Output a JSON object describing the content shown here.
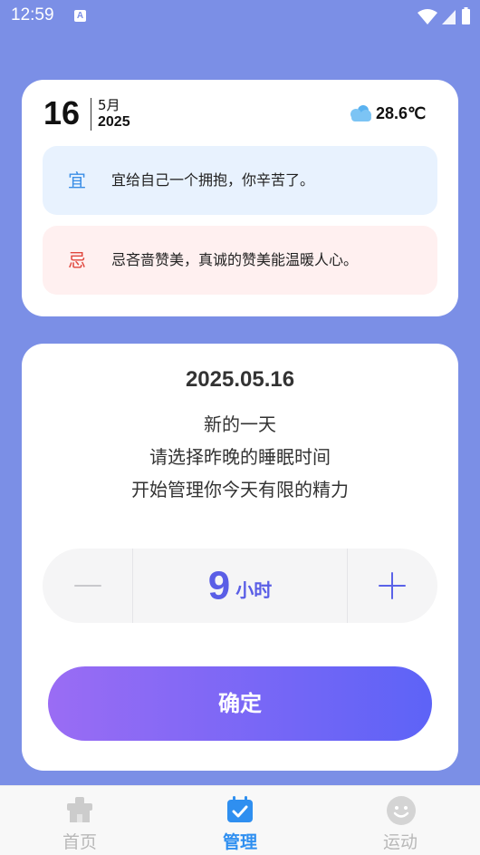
{
  "status_bar": {
    "time": "12:59",
    "notification_icon": "a-app-icon",
    "icons": [
      "wifi-icon",
      "signal-icon",
      "battery-icon"
    ]
  },
  "today": {
    "day": "16",
    "month": "5月",
    "year": "2025",
    "weather_icon": "cloud-icon",
    "temperature": "28.6℃"
  },
  "advice": {
    "good_char": "宜",
    "good_text": "宜给自己一个拥抱，你辛苦了。",
    "bad_char": "忌",
    "bad_text": "忌吝啬赞美，真诚的赞美能温暖人心。"
  },
  "main": {
    "date": "2025.05.16",
    "line1": "新的一天",
    "line2": "请选择昨晚的睡眠时间",
    "line3": "开始管理你今天有限的精力",
    "hours_value": "9",
    "hours_unit": "小时",
    "confirm_label": "确定"
  },
  "tabs": [
    {
      "label": "首页",
      "icon": "home-icon",
      "active": false
    },
    {
      "label": "管理",
      "icon": "calendar-check-icon",
      "active": true
    },
    {
      "label": "运动",
      "icon": "smile-icon",
      "active": false
    }
  ],
  "colors": {
    "background": "#7b8fe6",
    "accent": "#5a5ee6",
    "tab_active": "#2f8ff0",
    "good": "#3a8ee6",
    "bad": "#e0473e"
  }
}
